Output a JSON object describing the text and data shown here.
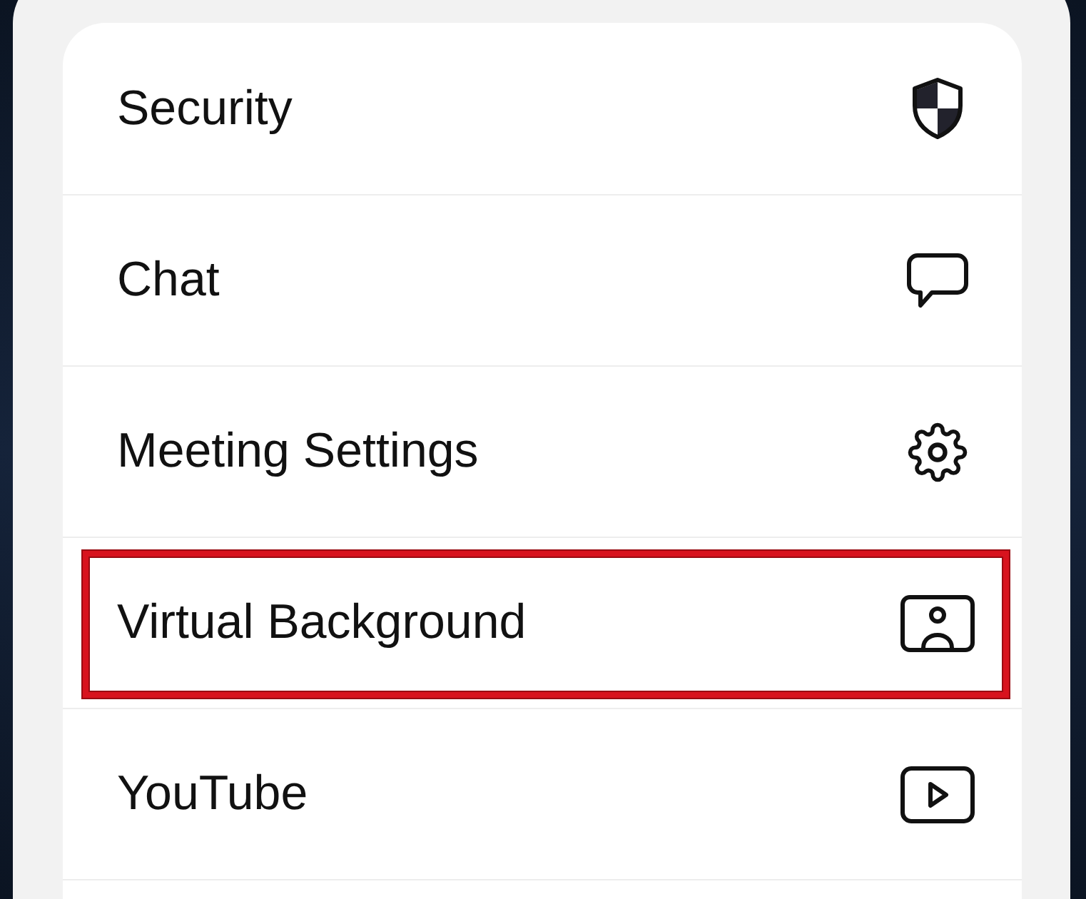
{
  "items": [
    {
      "label": "Security",
      "highlighted": false
    },
    {
      "label": "Chat",
      "highlighted": false
    },
    {
      "label": "Meeting Settings",
      "highlighted": false
    },
    {
      "label": "Virtual Background",
      "highlighted": true
    },
    {
      "label": "YouTube",
      "highlighted": false
    }
  ]
}
